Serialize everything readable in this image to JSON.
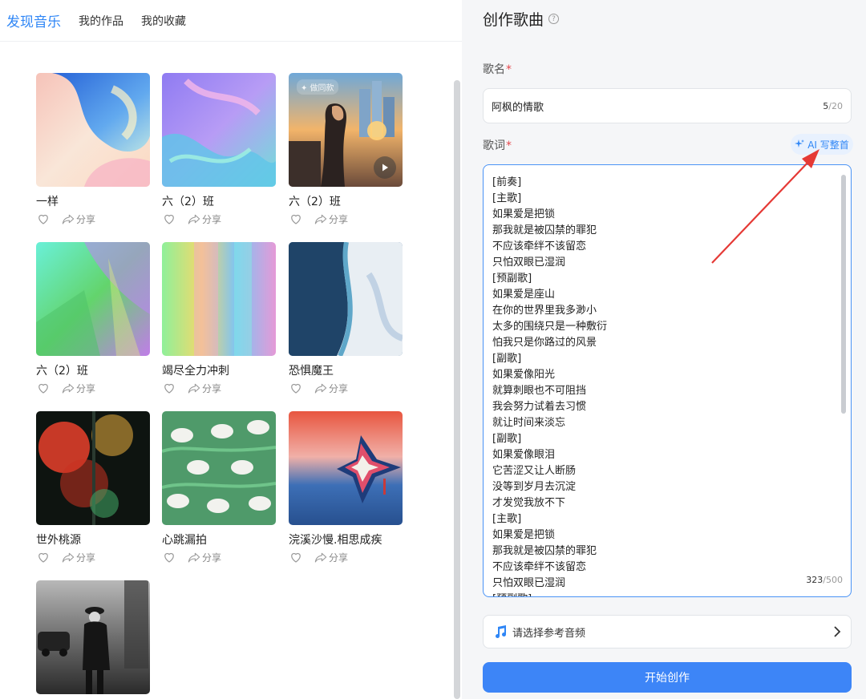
{
  "nav": {
    "tabs": [
      {
        "label": "发现音乐",
        "active": true
      },
      {
        "label": "我的作品",
        "active": false
      },
      {
        "label": "我的收藏",
        "active": false
      }
    ]
  },
  "songs": [
    {
      "title": "一样",
      "share": "分享"
    },
    {
      "title": "六（2）班",
      "share": "分享"
    },
    {
      "title": "六（2）班",
      "share": "分享",
      "badge": "✦ 做同款",
      "playable": true
    },
    {
      "title": "六（2）班",
      "share": "分享"
    },
    {
      "title": "竭尽全力冲刺",
      "share": "分享"
    },
    {
      "title": "恐惧魔王",
      "share": "分享"
    },
    {
      "title": "世外桃源",
      "share": "分享"
    },
    {
      "title": "心跳漏拍",
      "share": "分享"
    },
    {
      "title": "浣溪沙慢.相思成疾",
      "share": "分享"
    },
    {
      "title": "",
      "share": ""
    }
  ],
  "panel": {
    "title": "创作歌曲",
    "help_icon": "question-circle-icon",
    "name_label": "歌名",
    "required_mark": "*",
    "name_value": "阿枫的情歌",
    "name_count": "5",
    "name_max": "/20",
    "lyrics_label": "歌词",
    "ai_button": "AI 写整首",
    "lyrics": [
      "[前奏]",
      "[主歌]",
      "如果爱是把锁",
      "那我就是被囚禁的罪犯",
      "不应该牵绊不该留恋",
      "只怕双眼已湿润",
      "[预副歌]",
      "如果爱是座山",
      "在你的世界里我多渺小",
      "太多的围绕只是一种敷衍",
      "怕我只是你路过的风景",
      "[副歌]",
      "如果爱像阳光",
      "就算刺眼也不可阻挡",
      "我会努力试着去习惯",
      "就让时间来淡忘",
      "[副歌]",
      "如果爱像眼泪",
      "它苦涩又让人断肠",
      "没等到岁月去沉淀",
      "才发觉我放不下",
      "[主歌]",
      "如果爱是把锁",
      "那我就是被囚禁的罪犯",
      "不应该牵绊不该留恋",
      "只怕双眼已湿润",
      "[预副歌]"
    ],
    "lyrics_count": "323",
    "lyrics_max": "/500",
    "audio_placeholder": "请选择参考音频",
    "start_button": "开始创作"
  },
  "colors": {
    "accent": "#2f86f6",
    "primary_button": "#3d85f7",
    "required": "#e5484d",
    "annotation_arrow": "#e53935"
  }
}
